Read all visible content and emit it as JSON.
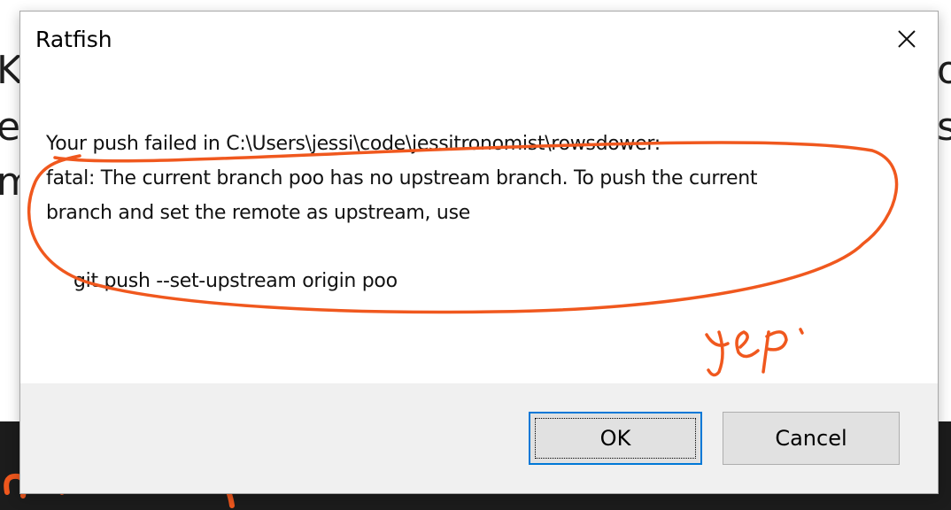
{
  "background": {
    "text_fragments_left": [
      "K,",
      "es",
      "m"
    ],
    "text_fragments_right": [
      "o",
      "s"
    ]
  },
  "dialog": {
    "title": "Ratfish",
    "message_lines": [
      "Your push failed in C:\\Users\\jessi\\code\\jessitronomist\\rowsdower:",
      "fatal: The current branch poo has no upstream branch. To push the current",
      "branch and set the remote as upstream, use"
    ],
    "command": "git push --set-upstream origin poo",
    "buttons": {
      "ok": "OK",
      "cancel": "Cancel"
    }
  },
  "annotation": {
    "color": "#f0581e",
    "handwritten_note": "yep."
  },
  "icons": {
    "close": "close-icon"
  }
}
